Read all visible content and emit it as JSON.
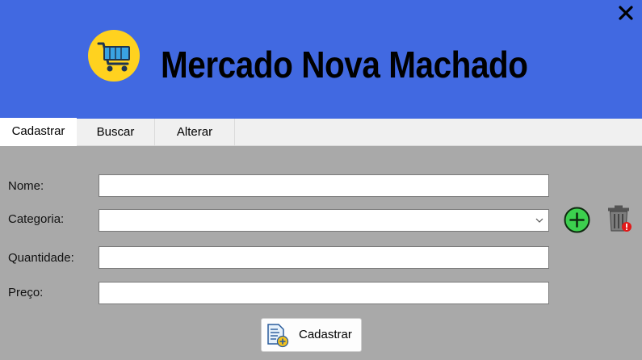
{
  "header": {
    "title": "Mercado Nova Machado",
    "logo_icon": "shopping-cart-icon",
    "close_icon": "close-icon",
    "bg_color": "#4169e1"
  },
  "tabs": [
    {
      "label": "Cadastrar",
      "active": true
    },
    {
      "label": "Buscar",
      "active": false
    },
    {
      "label": "Alterar",
      "active": false
    }
  ],
  "form": {
    "nome": {
      "label": "Nome:",
      "value": ""
    },
    "categoria": {
      "label": "Categoria:",
      "value": ""
    },
    "quantidade": {
      "label": "Quantidade:",
      "value": ""
    },
    "preco": {
      "label": "Preço:",
      "value": ""
    },
    "add_category_icon": "plus-circle-icon",
    "delete_category_icon": "trash-icon"
  },
  "submit": {
    "label": "Cadastrar",
    "icon": "document-add-icon"
  }
}
